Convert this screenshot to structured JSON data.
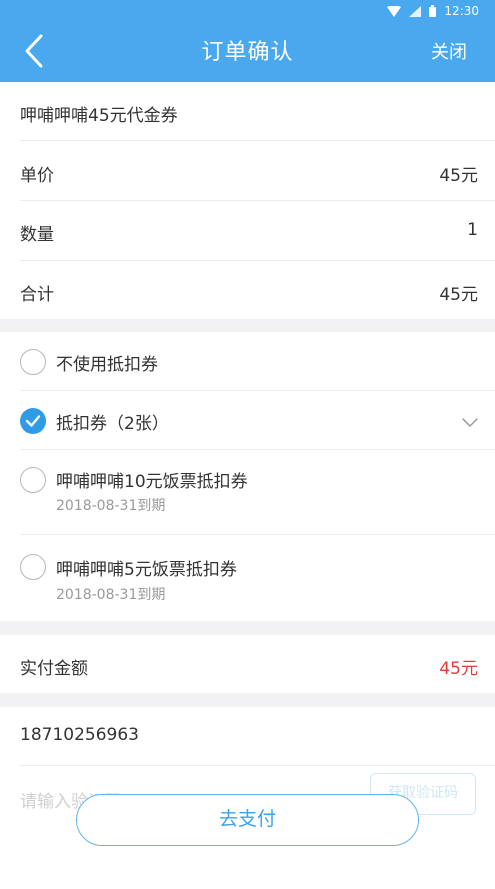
{
  "status_bar": {
    "time": "12:30"
  },
  "header": {
    "title": "订单确认",
    "close_label": "关闭"
  },
  "product": {
    "name": "呷哺呷哺45元代金券"
  },
  "order": {
    "unit_price_label": "单价",
    "unit_price_value": "45元",
    "quantity_label": "数量",
    "quantity_value": "1",
    "total_label": "合计",
    "total_value": "45元"
  },
  "coupons": {
    "no_coupon_label": "不使用抵扣券",
    "coupon_group_label": "抵扣券（2张）",
    "items": [
      {
        "title": "呷哺呷哺10元饭票抵扣券",
        "expiry": "2018-08-31到期"
      },
      {
        "title": "呷哺呷哺5元饭票抵扣券",
        "expiry": "2018-08-31到期"
      }
    ]
  },
  "payment": {
    "actual_label": "实付金额",
    "actual_value": "45元"
  },
  "contact": {
    "phone": "18710256963",
    "code_placeholder": "请输入验证码",
    "get_code_label": "获取验证码"
  },
  "actions": {
    "pay_label": "去支付"
  },
  "colors": {
    "primary": "#4aa8ee",
    "accent_red": "#e23b3b",
    "check_blue": "#2f9be6"
  }
}
